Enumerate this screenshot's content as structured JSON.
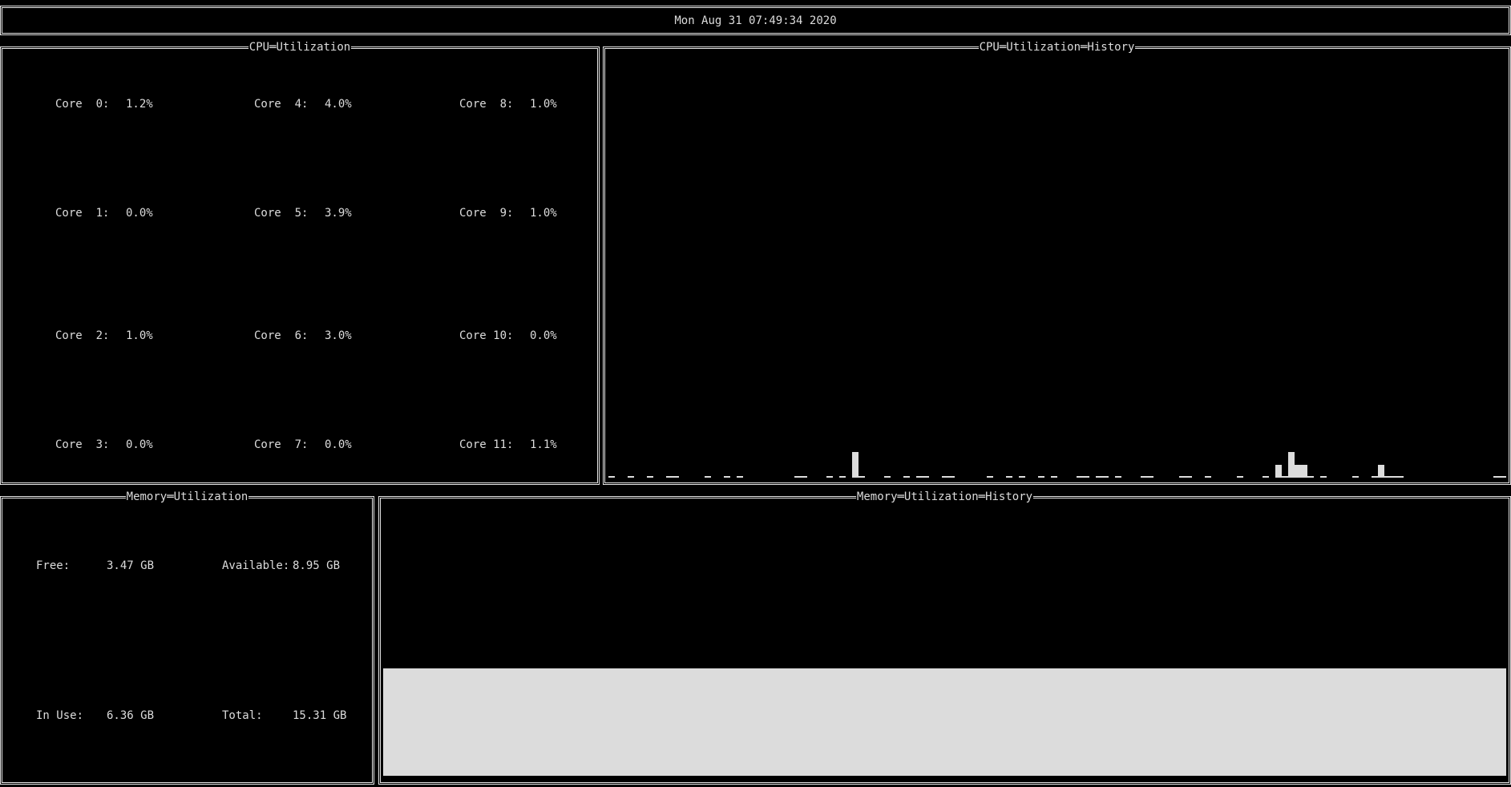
{
  "header": {
    "datetime": "Mon Aug 31 07:49:34 2020"
  },
  "cpu_util": {
    "title": "CPU═Utilization",
    "cores": [
      {
        "label": "Core  0:",
        "value": "1.2%"
      },
      {
        "label": "Core  1:",
        "value": "0.0%"
      },
      {
        "label": "Core  2:",
        "value": "1.0%"
      },
      {
        "label": "Core  3:",
        "value": "0.0%"
      },
      {
        "label": "Core  4:",
        "value": "4.0%"
      },
      {
        "label": "Core  5:",
        "value": "3.9%"
      },
      {
        "label": "Core  6:",
        "value": "3.0%"
      },
      {
        "label": "Core  7:",
        "value": "0.0%"
      },
      {
        "label": "Core  8:",
        "value": "1.0%"
      },
      {
        "label": "Core  9:",
        "value": "1.0%"
      },
      {
        "label": "Core 10:",
        "value": "0.0%"
      },
      {
        "label": "Core 11:",
        "value": "1.1%"
      }
    ]
  },
  "cpu_history": {
    "title": "CPU═Utilization═History"
  },
  "mem_util": {
    "title": "Memory═Utilization",
    "free_label": "Free:",
    "free_value": "3.47 GB",
    "available_label": "Available:",
    "available_value": "8.95 GB",
    "inuse_label": "In Use:",
    "inuse_value": "6.36 GB",
    "total_label": "Total:",
    "total_value": "15.31 GB"
  },
  "mem_history": {
    "title": "Memory═Utilization═History"
  },
  "colors": {
    "background": "#000000",
    "foreground": "#dcdcdc",
    "border": "#e6e6e6"
  }
}
